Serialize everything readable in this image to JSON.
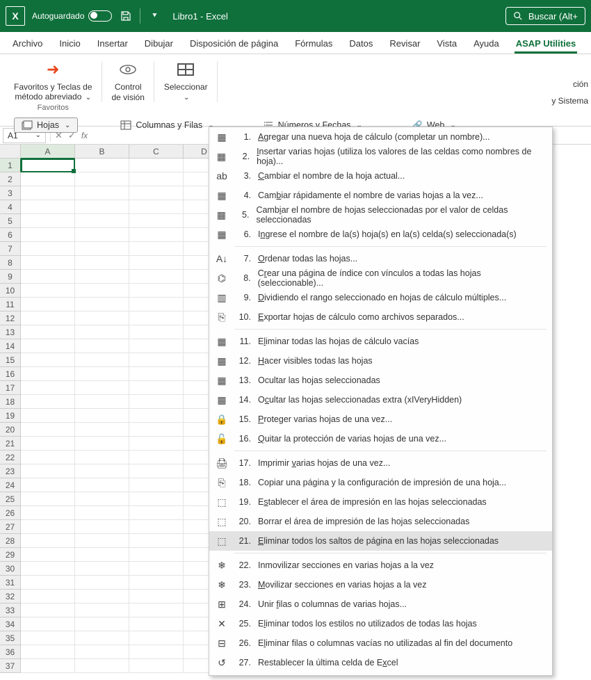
{
  "titlebar": {
    "autoguardado": "Autoguardado",
    "doc_title": "Libro1  -  Excel",
    "search_placeholder": "Buscar (Alt+"
  },
  "tabs": {
    "archivo": "Archivo",
    "inicio": "Inicio",
    "insertar": "Insertar",
    "dibujar": "Dibujar",
    "disposicion": "Disposición de página",
    "formulas": "Fórmulas",
    "datos": "Datos",
    "revisar": "Revisar",
    "vista": "Vista",
    "ayuda": "Ayuda",
    "asap": "ASAP Utilities"
  },
  "ribbon": {
    "favoritos_btn": "Favoritos y Teclas de método abreviado",
    "favoritos_label": "Favoritos",
    "control_vision": "Control de visión",
    "seleccionar": "Seleccionar",
    "hojas": "Hojas",
    "columnas_filas": "Columnas y Filas",
    "numeros_fechas": "Números y Fechas",
    "web": "Web",
    "right1": "ción",
    "right2": "y Sistema"
  },
  "formulabar": {
    "cell_ref": "A1"
  },
  "columns": [
    "A",
    "B",
    "C",
    "D"
  ],
  "menu": {
    "items": [
      {
        "n": "1.",
        "label": "Agregar una nueva hoja de cálculo (completar un nombre)...",
        "u": 0
      },
      {
        "n": "2.",
        "label": "Insertar varias hojas (utiliza los valores de las celdas como nombres de hoja)...",
        "u": 0
      },
      {
        "n": "3.",
        "label": "Cambiar el nombre de la hoja actual...",
        "u": 0
      },
      {
        "n": "4.",
        "label": "Cambiar rápidamente el nombre de varias hojas a la vez...",
        "u": 3
      },
      {
        "n": "5.",
        "label": "Cambiar el nombre de hojas seleccionadas por el valor de celdas seleccionadas",
        "u": 4
      },
      {
        "n": "6.",
        "label": "Ingrese el nombre de la(s) hoja(s) en la(s) celda(s) seleccionada(s)",
        "u": 1
      }
    ],
    "items2": [
      {
        "n": "7.",
        "label": "Ordenar todas las hojas...",
        "u": 0
      },
      {
        "n": "8.",
        "label": "Crear una página de índice con vínculos a todas las hojas (seleccionable)...",
        "u": 1
      },
      {
        "n": "9.",
        "label": "Dividiendo el rango seleccionado en hojas de cálculo múltiples...",
        "u": 0
      },
      {
        "n": "10.",
        "label": "Exportar hojas de cálculo como archivos separados...",
        "u": 0
      }
    ],
    "items3": [
      {
        "n": "11.",
        "label": "Eliminar todas las hojas de cálculo vacías",
        "u": 1
      },
      {
        "n": "12.",
        "label": "Hacer visibles todas las hojas",
        "u": 0
      },
      {
        "n": "13.",
        "label": "Ocultar las hojas seleccionadas",
        "u": -1
      },
      {
        "n": "14.",
        "label": "Ocultar las hojas seleccionadas extra (xIVeryHidden)",
        "u": 1
      },
      {
        "n": "15.",
        "label": "Proteger varias hojas de una vez...",
        "u": 0
      },
      {
        "n": "16.",
        "label": "Quitar la protección de varias hojas de una vez...",
        "u": 0
      }
    ],
    "items4": [
      {
        "n": "17.",
        "label": "Imprimir varias hojas de una vez...",
        "u": 9
      },
      {
        "n": "18.",
        "label": "Copiar una página y la configuración de impresión de una hoja...",
        "u": -1
      },
      {
        "n": "19.",
        "label": "Establecer el área de impresión en las hojas seleccionadas",
        "u": 1
      },
      {
        "n": "20.",
        "label": "Borrar el área de impresión de las hojas seleccionadas",
        "u": -1
      },
      {
        "n": "21.",
        "label": "Eliminar todos los saltos de página en las hojas seleccionadas",
        "u": 0,
        "hover": true
      }
    ],
    "items5": [
      {
        "n": "22.",
        "label": "Inmovilizar secciones en varias hojas a la vez",
        "u": -1
      },
      {
        "n": "23.",
        "label": "Movilizar secciones en varias hojas a la vez",
        "u": 0
      },
      {
        "n": "24.",
        "label": "Unir filas o columnas de varias hojas...",
        "u": 5
      },
      {
        "n": "25.",
        "label": "Eliminar todos los estilos no utilizados de todas las hojas",
        "u": 1
      },
      {
        "n": "26.",
        "label": "Eliminar filas o columnas vacías no utilizadas al fin del documento",
        "u": 1
      },
      {
        "n": "27.",
        "label": "Restablecer la última celda de Excel",
        "u": 32
      }
    ]
  }
}
